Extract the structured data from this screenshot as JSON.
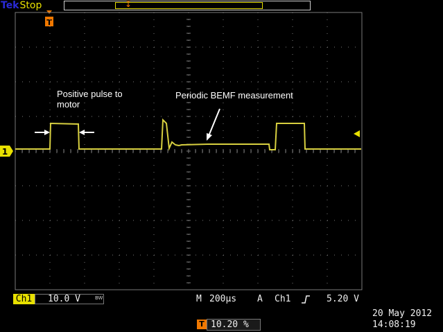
{
  "header": {
    "brand": "Tek",
    "acquisition_state": "Stop"
  },
  "trigger": {
    "marker_label": "T"
  },
  "waveform": {
    "channel_marker": "1"
  },
  "annotations": {
    "pulse_note": "Positive pulse to\nmotor",
    "bemf_note": "Periodic BEMF measurement"
  },
  "status_bar": {
    "channel": "Ch1",
    "volts_per_div": "10.0 V",
    "bandwidth_mark": "BW",
    "timebase_prefix": "M",
    "time_per_div": "200µs",
    "trigger_prefix": "A",
    "trigger_source": "Ch1",
    "trigger_slope_icon": "rising-edge-icon",
    "trigger_level": "5.20 V",
    "trigger_position": "10.20 %",
    "date": "20 May 2012",
    "time": "14:08:19"
  },
  "colors": {
    "trace": "#d8d040",
    "channel": "#e8e000",
    "trigger": "#f07800",
    "grid": "#7a7a7a"
  }
}
